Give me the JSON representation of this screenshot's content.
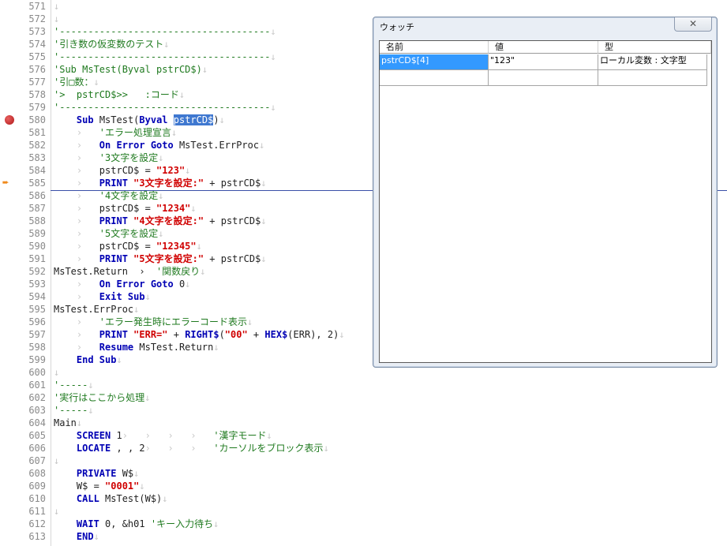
{
  "editor": {
    "lines": [
      {
        "n": "571",
        "segs": [
          {
            "t": "↓",
            "c": "arrow-mark"
          }
        ]
      },
      {
        "n": "572",
        "segs": [
          {
            "t": "↓",
            "c": "arrow-mark"
          }
        ]
      },
      {
        "n": "573",
        "segs": [
          {
            "t": "'-------------------------------------",
            "c": "cm"
          },
          {
            "t": "↓",
            "c": "arrow-mark"
          }
        ]
      },
      {
        "n": "574",
        "segs": [
          {
            "t": "'引き数の仮変数のテスト",
            "c": "cm"
          },
          {
            "t": "↓",
            "c": "arrow-mark"
          }
        ]
      },
      {
        "n": "575",
        "segs": [
          {
            "t": "'-------------------------------------",
            "c": "cm"
          },
          {
            "t": "↓",
            "c": "arrow-mark"
          }
        ]
      },
      {
        "n": "576",
        "segs": [
          {
            "t": "'Sub MsTest(Byval pstrCD$)",
            "c": "cm"
          },
          {
            "t": "↓",
            "c": "arrow-mark"
          }
        ]
      },
      {
        "n": "577",
        "segs": [
          {
            "t": "'引□数：",
            "c": "cm"
          },
          {
            "t": "↓",
            "c": "arrow-mark"
          }
        ]
      },
      {
        "n": "578",
        "segs": [
          {
            "t": "'>  pstrCD$>>   :コード",
            "c": "cm"
          },
          {
            "t": "↓",
            "c": "arrow-mark"
          }
        ]
      },
      {
        "n": "579",
        "segs": [
          {
            "t": "'-------------------------------------",
            "c": "cm"
          },
          {
            "t": "↓",
            "c": "arrow-mark"
          }
        ]
      },
      {
        "n": "580",
        "segs": [
          {
            "t": "    "
          },
          {
            "t": "Sub",
            "c": "kw"
          },
          {
            "t": " MsTest("
          },
          {
            "t": "Byval",
            "c": "kw"
          },
          {
            "t": " "
          },
          {
            "t": "pstrCD$",
            "c": "sel"
          },
          {
            "t": ")"
          },
          {
            "t": "↓",
            "c": "arrow-mark"
          }
        ]
      },
      {
        "n": "581",
        "segs": [
          {
            "t": "    ›   ",
            "c": "arrow-mark"
          },
          {
            "t": "'エラー処理宣言",
            "c": "cm"
          },
          {
            "t": "↓",
            "c": "arrow-mark"
          }
        ]
      },
      {
        "n": "582",
        "segs": [
          {
            "t": "    ›   ",
            "c": "arrow-mark"
          },
          {
            "t": "On Error Goto",
            "c": "kw"
          },
          {
            "t": " MsTest.ErrProc"
          },
          {
            "t": "↓",
            "c": "arrow-mark"
          }
        ]
      },
      {
        "n": "583",
        "segs": [
          {
            "t": "    ›   ",
            "c": "arrow-mark"
          },
          {
            "t": "'3文字を設定",
            "c": "cm"
          },
          {
            "t": "↓",
            "c": "arrow-mark"
          }
        ]
      },
      {
        "n": "584",
        "segs": [
          {
            "t": "    ›   ",
            "c": "arrow-mark"
          },
          {
            "t": "pstrCD$ = "
          },
          {
            "t": "\"123\"",
            "c": "str"
          },
          {
            "t": "↓",
            "c": "arrow-mark"
          }
        ]
      },
      {
        "n": "585",
        "segs": [
          {
            "t": "    ›   ",
            "c": "arrow-mark"
          },
          {
            "t": "PRINT",
            "c": "kw"
          },
          {
            "t": " "
          },
          {
            "t": "\"3文字を設定:\"",
            "c": "str"
          },
          {
            "t": " + pstrCD$"
          },
          {
            "t": "↓",
            "c": "arrow-mark"
          }
        ]
      },
      {
        "n": "586",
        "segs": [
          {
            "t": "    ›   ",
            "c": "arrow-mark"
          },
          {
            "t": "'4文字を設定",
            "c": "cm"
          },
          {
            "t": "↓",
            "c": "arrow-mark"
          }
        ]
      },
      {
        "n": "587",
        "segs": [
          {
            "t": "    ›   ",
            "c": "arrow-mark"
          },
          {
            "t": "pstrCD$ = "
          },
          {
            "t": "\"1234\"",
            "c": "str"
          },
          {
            "t": "↓",
            "c": "arrow-mark"
          }
        ]
      },
      {
        "n": "588",
        "segs": [
          {
            "t": "    ›   ",
            "c": "arrow-mark"
          },
          {
            "t": "PRINT",
            "c": "kw"
          },
          {
            "t": " "
          },
          {
            "t": "\"4文字を設定:\"",
            "c": "str"
          },
          {
            "t": " + pstrCD$"
          },
          {
            "t": "↓",
            "c": "arrow-mark"
          }
        ]
      },
      {
        "n": "589",
        "segs": [
          {
            "t": "    ›   ",
            "c": "arrow-mark"
          },
          {
            "t": "'5文字を設定",
            "c": "cm"
          },
          {
            "t": "↓",
            "c": "arrow-mark"
          }
        ]
      },
      {
        "n": "590",
        "segs": [
          {
            "t": "    ›   ",
            "c": "arrow-mark"
          },
          {
            "t": "pstrCD$ = "
          },
          {
            "t": "\"12345\"",
            "c": "str"
          },
          {
            "t": "↓",
            "c": "arrow-mark"
          }
        ]
      },
      {
        "n": "591",
        "segs": [
          {
            "t": "    ›   ",
            "c": "arrow-mark"
          },
          {
            "t": "PRINT",
            "c": "kw"
          },
          {
            "t": " "
          },
          {
            "t": "\"5文字を設定:\"",
            "c": "str"
          },
          {
            "t": " + pstrCD$"
          },
          {
            "t": "↓",
            "c": "arrow-mark"
          }
        ]
      },
      {
        "n": "592",
        "segs": [
          {
            "t": "MsTest.Return  ›  "
          },
          {
            "t": "'関数戻り",
            "c": "cm"
          },
          {
            "t": "↓",
            "c": "arrow-mark"
          }
        ]
      },
      {
        "n": "593",
        "segs": [
          {
            "t": "    ›   ",
            "c": "arrow-mark"
          },
          {
            "t": "On Error Goto",
            "c": "kw"
          },
          {
            "t": " 0"
          },
          {
            "t": "↓",
            "c": "arrow-mark"
          }
        ]
      },
      {
        "n": "594",
        "segs": [
          {
            "t": "    ›   ",
            "c": "arrow-mark"
          },
          {
            "t": "Exit Sub",
            "c": "kw"
          },
          {
            "t": "↓",
            "c": "arrow-mark"
          }
        ]
      },
      {
        "n": "595",
        "segs": [
          {
            "t": "MsTest.ErrProc"
          },
          {
            "t": "↓",
            "c": "arrow-mark"
          }
        ]
      },
      {
        "n": "596",
        "segs": [
          {
            "t": "    ›   ",
            "c": "arrow-mark"
          },
          {
            "t": "'エラー発生時にエラーコード表示",
            "c": "cm"
          },
          {
            "t": "↓",
            "c": "arrow-mark"
          }
        ]
      },
      {
        "n": "597",
        "segs": [
          {
            "t": "    ›   ",
            "c": "arrow-mark"
          },
          {
            "t": "PRINT",
            "c": "kw"
          },
          {
            "t": " "
          },
          {
            "t": "\"ERR=\"",
            "c": "str"
          },
          {
            "t": " + "
          },
          {
            "t": "RIGHT$",
            "c": "kw"
          },
          {
            "t": "("
          },
          {
            "t": "\"00\"",
            "c": "str"
          },
          {
            "t": " + "
          },
          {
            "t": "HEX$",
            "c": "kw"
          },
          {
            "t": "(ERR), 2)"
          },
          {
            "t": "↓",
            "c": "arrow-mark"
          }
        ]
      },
      {
        "n": "598",
        "segs": [
          {
            "t": "    ›   ",
            "c": "arrow-mark"
          },
          {
            "t": "Resume",
            "c": "kw"
          },
          {
            "t": " MsTest.Return"
          },
          {
            "t": "↓",
            "c": "arrow-mark"
          }
        ]
      },
      {
        "n": "599",
        "segs": [
          {
            "t": "    "
          },
          {
            "t": "End Sub",
            "c": "kw"
          },
          {
            "t": "↓",
            "c": "arrow-mark"
          }
        ]
      },
      {
        "n": "600",
        "segs": [
          {
            "t": "↓",
            "c": "arrow-mark"
          }
        ]
      },
      {
        "n": "601",
        "segs": [
          {
            "t": "'-----",
            "c": "cm"
          },
          {
            "t": "↓",
            "c": "arrow-mark"
          }
        ]
      },
      {
        "n": "602",
        "segs": [
          {
            "t": "'実行はここから処理",
            "c": "cm"
          },
          {
            "t": "↓",
            "c": "arrow-mark"
          }
        ]
      },
      {
        "n": "603",
        "segs": [
          {
            "t": "'-----",
            "c": "cm"
          },
          {
            "t": "↓",
            "c": "arrow-mark"
          }
        ]
      },
      {
        "n": "604",
        "segs": [
          {
            "t": "Main"
          },
          {
            "t": "↓",
            "c": "arrow-mark"
          }
        ]
      },
      {
        "n": "605",
        "segs": [
          {
            "t": "    "
          },
          {
            "t": "SCREEN",
            "c": "kw"
          },
          {
            "t": " 1"
          },
          {
            "t": "›   ›   ›   ›   ",
            "c": "arrow-mark"
          },
          {
            "t": "'漢字モード",
            "c": "cm"
          },
          {
            "t": "↓",
            "c": "arrow-mark"
          }
        ]
      },
      {
        "n": "606",
        "segs": [
          {
            "t": "    "
          },
          {
            "t": "LOCATE",
            "c": "kw"
          },
          {
            "t": " , , 2"
          },
          {
            "t": "›   ›   ›   ",
            "c": "arrow-mark"
          },
          {
            "t": "'カーソルをブロック表示",
            "c": "cm"
          },
          {
            "t": "↓",
            "c": "arrow-mark"
          }
        ]
      },
      {
        "n": "607",
        "segs": [
          {
            "t": "↓",
            "c": "arrow-mark"
          }
        ]
      },
      {
        "n": "608",
        "segs": [
          {
            "t": "    "
          },
          {
            "t": "PRIVATE",
            "c": "kw"
          },
          {
            "t": " W$"
          },
          {
            "t": "↓",
            "c": "arrow-mark"
          }
        ]
      },
      {
        "n": "609",
        "segs": [
          {
            "t": "    W$ = "
          },
          {
            "t": "\"0001\"",
            "c": "str"
          },
          {
            "t": "↓",
            "c": "arrow-mark"
          }
        ]
      },
      {
        "n": "610",
        "segs": [
          {
            "t": "    "
          },
          {
            "t": "CALL",
            "c": "kw"
          },
          {
            "t": " MsTest(W$)"
          },
          {
            "t": "↓",
            "c": "arrow-mark"
          }
        ]
      },
      {
        "n": "611",
        "segs": [
          {
            "t": "↓",
            "c": "arrow-mark"
          }
        ]
      },
      {
        "n": "612",
        "segs": [
          {
            "t": "    "
          },
          {
            "t": "WAIT",
            "c": "kw"
          },
          {
            "t": " 0, &h01 "
          },
          {
            "t": "'キー入力待ち",
            "c": "cm"
          },
          {
            "t": "↓",
            "c": "arrow-mark"
          }
        ]
      },
      {
        "n": "613",
        "segs": [
          {
            "t": "    "
          },
          {
            "t": "END",
            "c": "kw"
          },
          {
            "t": "↓",
            "c": "arrow-mark"
          }
        ]
      }
    ],
    "breakpoint_line": "580",
    "current_line": "585"
  },
  "watch": {
    "title": "ウォッチ",
    "close": "✕",
    "columns": [
      "名前",
      "値",
      "型"
    ],
    "rows": [
      {
        "name": "pstrCD$[4]",
        "value": "\"123\"",
        "type": "ローカル変数 : 文字型"
      },
      {
        "name": "",
        "value": "",
        "type": ""
      }
    ]
  }
}
